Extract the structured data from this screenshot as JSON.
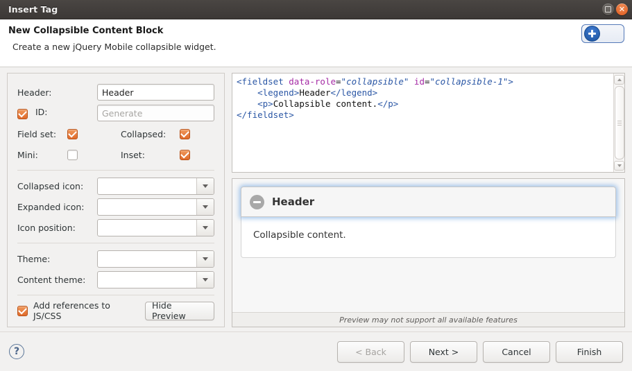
{
  "window": {
    "title": "Insert Tag",
    "restore_icon": "restore-icon",
    "close_icon": "close-icon"
  },
  "banner": {
    "title": "New Collapsible Content Block",
    "subtitle": "Create a new jQuery Mobile collapsible widget.",
    "action_icon": "plus-icon"
  },
  "form": {
    "header": {
      "label": "Header:",
      "value": "Header"
    },
    "id": {
      "label": "ID:",
      "placeholder": "Generate",
      "checked": true
    },
    "field_set": {
      "label": "Field set:",
      "checked": true
    },
    "collapsed": {
      "label": "Collapsed:",
      "checked": true
    },
    "mini": {
      "label": "Mini:",
      "checked": false
    },
    "inset": {
      "label": "Inset:",
      "checked": true
    },
    "collapsed_icon": {
      "label": "Collapsed icon:",
      "value": ""
    },
    "expanded_icon": {
      "label": "Expanded icon:",
      "value": ""
    },
    "icon_position": {
      "label": "Icon position:",
      "value": ""
    },
    "theme": {
      "label": "Theme:",
      "value": ""
    },
    "content_theme": {
      "label": "Content theme:",
      "value": ""
    },
    "add_references": {
      "label": "Add references to JS/CSS",
      "checked": true
    },
    "hide_preview_button": "Hide Preview"
  },
  "code": {
    "line1": {
      "open": "<",
      "tag": "fieldset",
      "space": " ",
      "attr": "data-role",
      "eq": "=",
      "val": "\"collapsible\"",
      "space2": " ",
      "attr2": "id",
      "eq2": "=",
      "val2": "\"collapsible-1\"",
      "close": ">"
    },
    "line2_open": "    <legend>",
    "line2_text": "Header",
    "line2_close": "</legend>",
    "line3_open": "    <p>",
    "line3_text": "Collapsible content.",
    "line3_close": "</p>",
    "line4": "</fieldset>"
  },
  "preview": {
    "header_title": "Header",
    "header_icon": "minus-circle-icon",
    "content": "Collapsible content.",
    "footer_note": "Preview may not support all available features"
  },
  "footer": {
    "help_icon": "help-icon",
    "back": "< Back",
    "next": "Next >",
    "cancel": "Cancel",
    "finish": "Finish"
  },
  "colors": {
    "checkbox_on": "#e06a2a",
    "accent_blue": "#2b57a5",
    "attr_purple": "#a52ba5",
    "close_orange": "#de5b1f",
    "focus_glow": "#5696dc"
  }
}
